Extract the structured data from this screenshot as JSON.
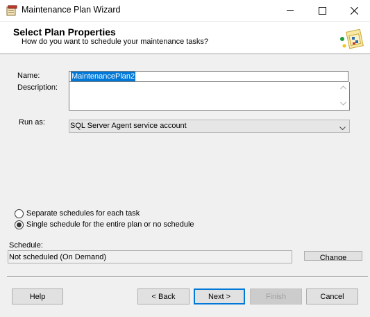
{
  "window": {
    "title": "Maintenance Plan Wizard"
  },
  "header": {
    "title": "Select Plan Properties",
    "subtitle": "How do you want to schedule your maintenance tasks?"
  },
  "form": {
    "name_label": "Name:",
    "name_value": "MaintenancePlan2",
    "description_label": "Description:",
    "description_value": "",
    "run_as_label": "Run as:",
    "run_as_value": "SQL Server Agent service account"
  },
  "schedule_options": [
    {
      "label": "Separate schedules for each task",
      "selected": false
    },
    {
      "label": "Single schedule for the entire plan or no schedule",
      "selected": true
    }
  ],
  "schedule": {
    "label": "Schedule:",
    "value": "Not scheduled (On Demand)",
    "change_label": "Change"
  },
  "buttons": {
    "help": "Help",
    "back": "< Back",
    "next": "Next >",
    "finish": "Finish",
    "cancel": "Cancel"
  },
  "icons": {
    "app": "wizard-app-icon",
    "header": "maintenance-plan-icon",
    "minimize": "minimize-icon",
    "maximize": "maximize-icon",
    "close": "close-icon",
    "dropdown": "chevron-down-icon"
  }
}
